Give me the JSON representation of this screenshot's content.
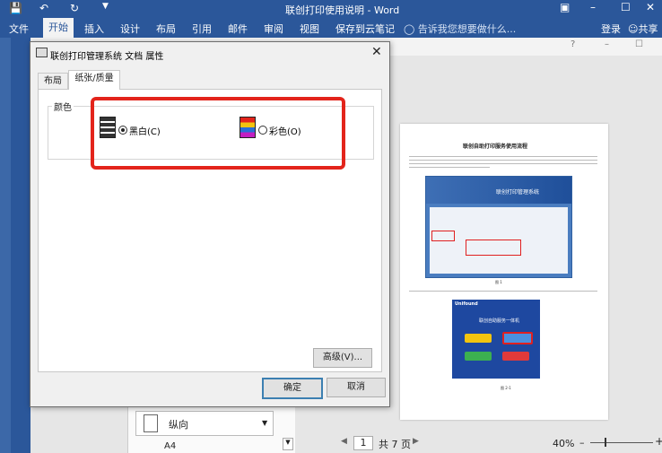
{
  "title_bar": {
    "save_icon": "save-icon",
    "undo_icon": "undo-icon",
    "redo_icon": "redo-icon",
    "customize_icon": "chevron-down-icon",
    "document_title": "联创打印使用说明 - Word"
  },
  "menu": {
    "items": [
      "文件",
      "开始",
      "插入",
      "设计",
      "布局",
      "引用",
      "邮件",
      "审阅",
      "视图",
      "保存到云笔记"
    ],
    "active": "开始",
    "tell_me": "告诉我您想要做什么...",
    "login": "登录",
    "share": "共享"
  },
  "dialog": {
    "title": "联创打印管理系统 文档 属性",
    "tabs": [
      "布局",
      "纸张/质量"
    ],
    "active_tab": "纸张/质量",
    "group_label": "颜色",
    "option_bw": "黑白(C)",
    "option_color": "彩色(O)",
    "selected": "黑白(C)",
    "advanced_button": "高级(V)...",
    "ok_button": "确定",
    "cancel_button": "取消"
  },
  "page_preview": {
    "heading": "联创自助打印服务使用流程",
    "screenshot1_title": "联创打印管理系统",
    "screenshot2_brand": "Unifound",
    "screenshot2_title": "联创自助服务一体机",
    "caption1": "图 1",
    "caption2": "图 2-1"
  },
  "page_setup_panel": {
    "orientation": "纵向",
    "paper": "A4"
  },
  "status_bar": {
    "page_number": "1",
    "page_total": "共 7 页",
    "zoom": "40%"
  },
  "colors": {
    "word_blue": "#2b579a",
    "highlight_red": "#e3241b"
  }
}
